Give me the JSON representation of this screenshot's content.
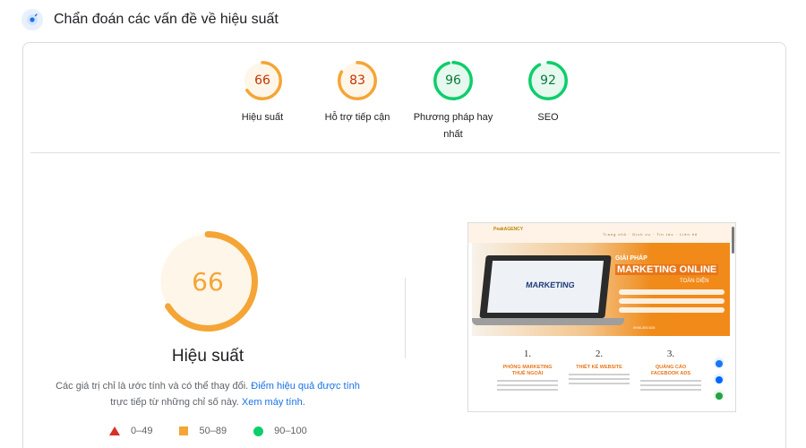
{
  "header": {
    "title": "Chẩn đoán các vấn đề về hiệu suất",
    "icon": "lighthouse-icon"
  },
  "categories": [
    {
      "label": "Hiệu suất",
      "score": "66",
      "level": 0.66,
      "color": "#f4a535",
      "text_color": "#c33300"
    },
    {
      "label": "Hỗ trợ tiếp cận",
      "score": "83",
      "level": 0.83,
      "color": "#f4a535",
      "text_color": "#c33300"
    },
    {
      "label_line1": "Phương pháp hay",
      "label_line2": "nhất",
      "score": "96",
      "level": 0.96,
      "color": "#0cce6b",
      "text_color": "#0d7a40"
    },
    {
      "label": "SEO",
      "score": "92",
      "level": 0.92,
      "color": "#0cce6b",
      "text_color": "#0d7a40"
    }
  ],
  "main": {
    "score": "66",
    "level": 0.66,
    "title": "Hiệu suất",
    "desc_prefix": "Các giá trị chỉ là ước tính và có thể thay đổi.",
    "link_calc": "Điểm hiệu quả được tính",
    "desc_mid": "trực tiếp từ những chỉ số này.",
    "link_calculator": "Xem máy tính."
  },
  "legend": [
    {
      "range": "0–49",
      "shape": "triangle",
      "color": "#d93025"
    },
    {
      "range": "50–89",
      "shape": "square",
      "color": "#f4a535"
    },
    {
      "range": "90–100",
      "shape": "circle",
      "color": "#0cce6b"
    }
  ],
  "screenshot": {
    "logo": "PeakAGENCY",
    "nav": "Trang chủ · Dịch vụ · Tin tức · Liên hệ",
    "hero_line1": "GIẢI PHÁP",
    "hero_line2": "MARKETING ONLINE",
    "hero_line3": "TOÀN DIỆN",
    "laptop_word": "MARKETING",
    "hero_phone": "0946.300.626",
    "services": [
      {
        "num": "1.",
        "title_line1": "PHÒNG MARKETING",
        "title_line2": "THUÊ NGOÀI"
      },
      {
        "num": "2.",
        "title_line1": "THIẾT KẾ WEBSITE",
        "title_line2": ""
      },
      {
        "num": "3.",
        "title_line1": "QUẢNG CÁO",
        "title_line2": "FACEBOOK ADS"
      }
    ]
  }
}
